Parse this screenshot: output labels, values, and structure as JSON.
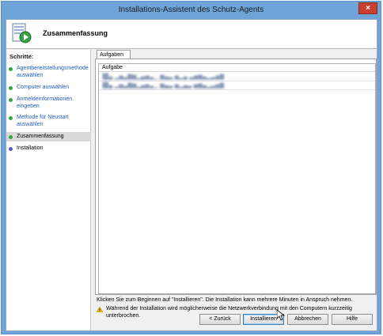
{
  "window": {
    "title": "Installations-Assistent des Schutz-Agents",
    "close_glyph": "×"
  },
  "header": {
    "title": "Zusammenfassung",
    "icon": "wizard-page-icon"
  },
  "steps": {
    "label": "Schritte:",
    "items": [
      {
        "label": "Agentbereitstellungsmethode auswählen",
        "state": "done"
      },
      {
        "label": "Computer auswählen",
        "state": "done"
      },
      {
        "label": "Anmeldeinformationen eingeben",
        "state": "done"
      },
      {
        "label": "Methode für Neustart auswählen",
        "state": "done"
      },
      {
        "label": "Zusammenfassung",
        "state": "current"
      },
      {
        "label": "Installation",
        "state": "pending"
      }
    ]
  },
  "tabs": [
    {
      "label": "Aufgaben",
      "selected": true
    }
  ],
  "grid": {
    "column": "Aufgabe",
    "rows": [
      "▐█▄ ▂▅▃▇▆▂▄▅▃▁ ▆▄▃ ▅▂▄ ▃▅▆▄▂▃▅▇",
      "▐█▄ ▂▅▃▇▆▂▄▅▃▁ ▆▄▃ ▅▂▄▃ ▅▆▄▂▃▅▇"
    ]
  },
  "info_text": "Klicken Sie zum Beginnen auf \"Installieren\". Die Installation kann mehrere Minuten in Anspruch nehmen.",
  "warning": {
    "icon": "warning-icon",
    "text": "Während der Installation wird möglicherweise die Netzwerkverbindung mit den Computern kurzzeitig unterbrochen."
  },
  "buttons": {
    "back": "< Zurück",
    "install": "Installieren",
    "cancel": "Abbrechen",
    "help": "Hilfe"
  },
  "colors": {
    "title_bar": "#6fa4d9",
    "close": "#c9402f",
    "step_done": "#32a845",
    "step_pending": "#5a5cc4",
    "link": "#1f5fbf"
  }
}
